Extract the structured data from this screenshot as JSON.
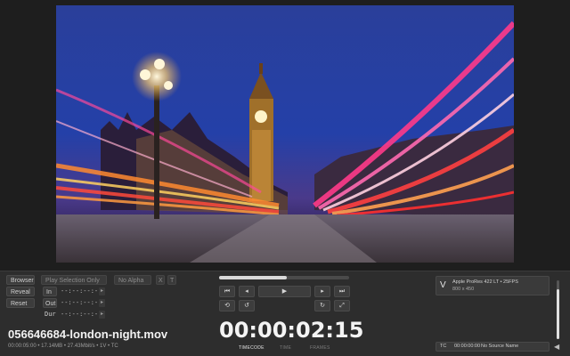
{
  "preview": {
    "description_icon": "image-preview"
  },
  "left": {
    "browser_label": "Browser",
    "reveal_label": "Reveal",
    "reset_label": "Reset",
    "play_selection_label": "Play Selection Only",
    "no_alpha_label": "No Alpha",
    "x_label": "X",
    "t_label": "T",
    "in_label": "In",
    "out_label": "Out",
    "dur_label": "Dur",
    "in_value": "--:--:--:--",
    "out_value": "--:--:--:--",
    "dur_value": "--:--:--:--"
  },
  "file": {
    "name": "056646684-london-night.mov",
    "info": "00:00:05:00 • 17.14MB • 27.43Mbit/s • 1V • TC"
  },
  "transport": {
    "progress": 0.52,
    "timecode": "00:00:02:15",
    "modes": [
      "TIMECODE",
      "TIME",
      "FRAMES"
    ],
    "active_mode": 0
  },
  "codec": {
    "track": "V",
    "format": "Apple ProRes 422 LT • 25FPS",
    "size": "800 x 450"
  },
  "tc": {
    "label": "TC",
    "value": "00:00:00:00",
    "source": "No Source Name"
  },
  "volume": {
    "level": 0.85
  },
  "colors": {
    "accent": "#e6e6e6",
    "background": "#2d2d2d"
  }
}
